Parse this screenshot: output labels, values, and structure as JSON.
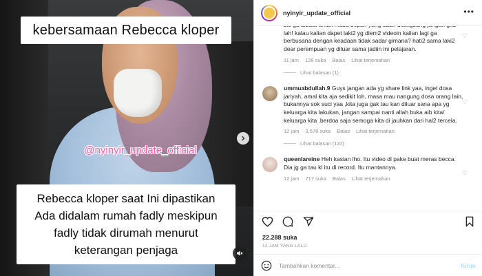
{
  "media": {
    "caption_top": "kebersamaan Rebecca kloper",
    "watermark": "@nyinyir_update_official",
    "caption_bottom": [
      "Rebecca kloper saat Ini dipastikan",
      "Ada didalam rumah fadly meskipun",
      "fadly tidak dirumah menurut",
      "keterangan penjaga"
    ]
  },
  "header": {
    "username": "nyinyir_update_official",
    "more_icon": "more-horizontal-icon"
  },
  "comments": [
    {
      "username": "",
      "text": "bis ga dibuat untuk masa depan yang udah dilangsung jangan gitu lah! kalau kalian dapet laki2 yg diem2 videoin kalian lagi ga berbusana dengan keadaan tidak sadar gimana? hati2 sama laki2 dear perempuan yg diluar sama jadiin ini pelajaran.",
      "time": "11 jam",
      "likes": "128 suka",
      "reply": "Balas",
      "translate": "Lihat terjemahan",
      "replies": "Lihat balasan (1)"
    },
    {
      "username": "ummuabdullah.9",
      "text": "Guys jangan ada yg share link yaa, inget dosa jariyah, amal kita aja sedikit loh, masa mau nangung dosa orang lain, bukannya sok suci yaa ,kita juga gak tau kan diluar sana apa yg keluarga kita lakukan, jangan sampai nanti allah buka aib kita/ keluarga kita .berdoa saja semoga kita di jauhkan dari hal2 tercela.",
      "time": "12 jam",
      "likes": "3,578 suka",
      "reply": "Balas",
      "translate": "Lihat terjemahan",
      "replies": "Lihat balasan (110)"
    },
    {
      "username": "queenlareine",
      "text": "Heh kasian lho. Itu video di pake buat meras becca. Dia jg ga tau kl itu di record. Itu mantannya.",
      "time": "12 jam",
      "likes": "717 suka",
      "reply": "Balas",
      "translate": "Lihat terjemahan"
    }
  ],
  "footer": {
    "likes": "22.288 suka",
    "time": "12 JAM YANG LALU",
    "comment_placeholder": "Tambahkan komentar...",
    "post_label": "Kirim"
  }
}
